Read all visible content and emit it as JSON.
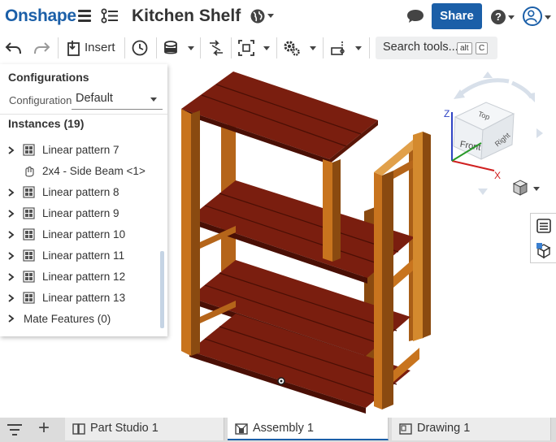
{
  "app": {
    "logo": "Onshape",
    "document_title": "Kitchen Shelf"
  },
  "header": {
    "share_label": "Share",
    "help_label": "?"
  },
  "toolbar": {
    "insert_label": "Insert",
    "search": {
      "label": "Search tools...",
      "shortcut_1": "alt",
      "shortcut_2": "C"
    }
  },
  "config_panel": {
    "title": "Configurations",
    "configuration_label": "Configuration",
    "configuration_value": "Default",
    "instances_title": "Instances (19)",
    "instances": [
      {
        "label": "Linear pattern 7",
        "type": "pattern",
        "expandable": true
      },
      {
        "label": "2x4 - Side Beam <1>",
        "type": "part",
        "expandable": false
      },
      {
        "label": "Linear pattern 8",
        "type": "pattern",
        "expandable": true
      },
      {
        "label": "Linear pattern 9",
        "type": "pattern",
        "expandable": true
      },
      {
        "label": "Linear pattern 10",
        "type": "pattern",
        "expandable": true
      },
      {
        "label": "Linear pattern 11",
        "type": "pattern",
        "expandable": true
      },
      {
        "label": "Linear pattern 12",
        "type": "pattern",
        "expandable": true
      },
      {
        "label": "Linear pattern 13",
        "type": "pattern",
        "expandable": true
      }
    ],
    "mate_features": "Mate Features (0)"
  },
  "viewcube": {
    "face_top": "Top",
    "face_front": "Front",
    "face_right": "Right",
    "axis_x": "X",
    "axis_z": "Z"
  },
  "tabs": [
    {
      "label": "Part Studio 1",
      "active": false
    },
    {
      "label": "Assembly 1",
      "active": true
    },
    {
      "label": "Drawing 1",
      "active": false
    }
  ],
  "colors": {
    "brand": "#1b5fa8",
    "shelf": "#7a1e0f",
    "post": "#c8741e",
    "post_dark": "#8a4a10"
  }
}
